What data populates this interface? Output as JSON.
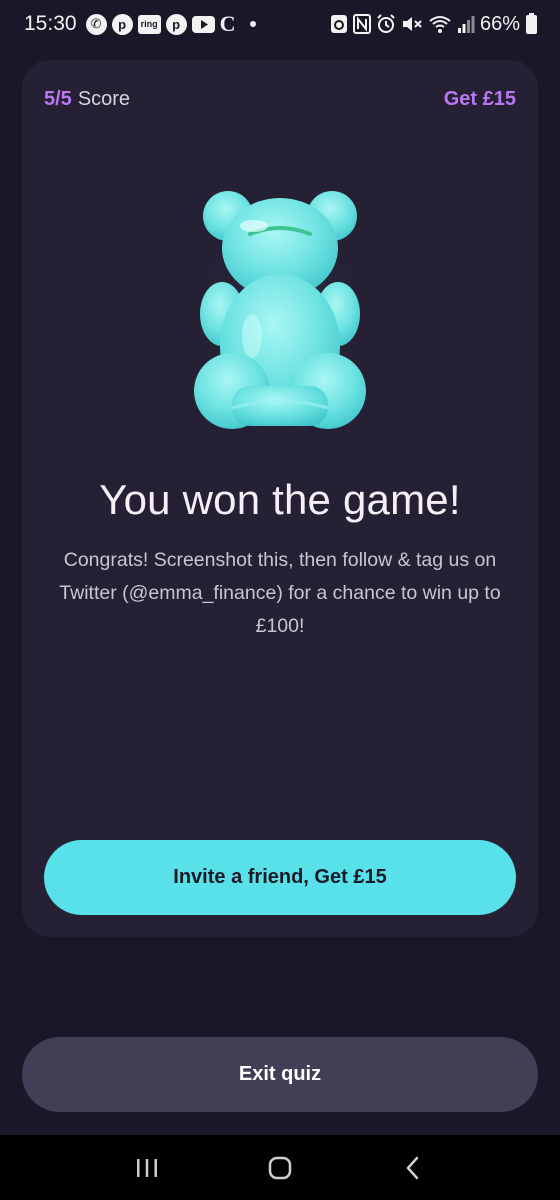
{
  "status_bar": {
    "time": "15:30",
    "ring_label": "ring",
    "battery": "66%"
  },
  "quiz": {
    "score_value": "5/5",
    "score_label": "Score",
    "reward_label": "Get £15",
    "headline": "You won the game!",
    "body": "Congrats! Screenshot this, then follow & tag us on Twitter (@emma_finance) for a chance to win up to £100!",
    "invite_button": "Invite a friend, Get £15",
    "exit_button": "Exit quiz"
  },
  "colors": {
    "background": "#1b1728",
    "card": "#252034",
    "accent_purple": "#b978f2",
    "accent_cyan": "#58e1e8",
    "exit_button": "#433e55"
  },
  "icons": {
    "status_left": [
      "whatsapp-icon",
      "pinterest-icon",
      "ring-icon",
      "pinterest-icon",
      "youtube-icon",
      "c-app-icon",
      "notification-dot"
    ],
    "status_right": [
      "recycle-icon",
      "nfc-icon",
      "alarm-icon",
      "mute-icon",
      "wifi-icon",
      "signal-icon",
      "battery-icon"
    ],
    "hero": "gummy-bear-illustration",
    "nav": [
      "recent-apps-icon",
      "home-icon",
      "back-icon"
    ]
  }
}
